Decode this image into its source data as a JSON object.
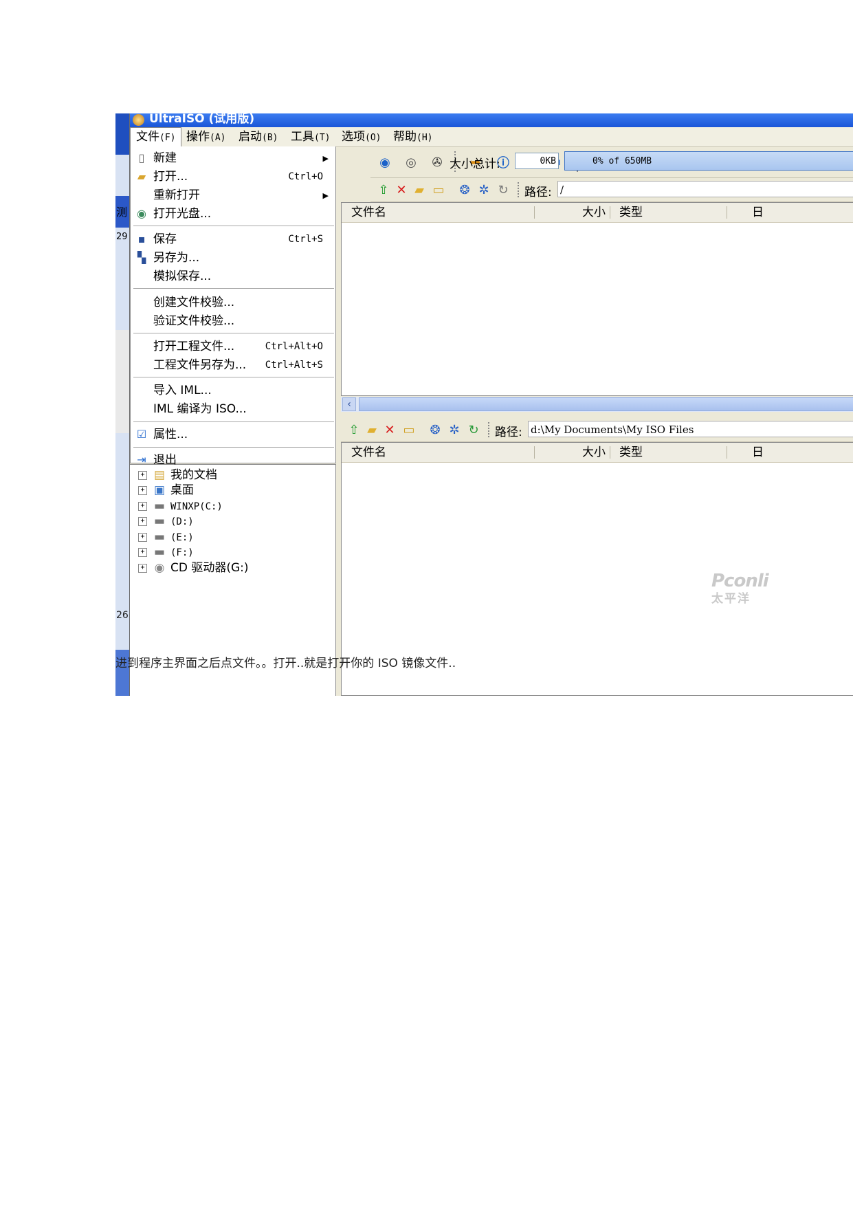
{
  "window": {
    "title": "UltraISO (试用版)"
  },
  "desktop_strip": {
    "text_1": "测",
    "text_2": "29",
    "text_3": "26"
  },
  "menubar": {
    "items": [
      {
        "label": "文件",
        "key": "(F)"
      },
      {
        "label": "操作",
        "key": "(A)"
      },
      {
        "label": "启动",
        "key": "(B)"
      },
      {
        "label": "工具",
        "key": "(T)"
      },
      {
        "label": "选项",
        "key": "(O)"
      },
      {
        "label": "帮助",
        "key": "(H)"
      }
    ]
  },
  "file_menu": {
    "new": "新建",
    "open": "打开...",
    "open_shortcut": "Ctrl+O",
    "reopen": "重新打开",
    "open_disc": "打开光盘...",
    "save": "保存",
    "save_shortcut": "Ctrl+S",
    "save_as": "另存为...",
    "simulate_save": "模拟保存...",
    "create_checksum": "创建文件校验...",
    "verify_checksum": "验证文件校验...",
    "open_project": "打开工程文件...",
    "open_project_shortcut": "Ctrl+Alt+O",
    "save_project_as": "工程文件另存为...",
    "save_project_shortcut": "Ctrl+Alt+S",
    "import_iml": "导入 IML...",
    "compile_iml": "IML 编译为 ISO...",
    "properties": "属性...",
    "exit": "退出"
  },
  "toolbar": {
    "size_total_label": "大小总计:",
    "size_value": "0KB",
    "capacity": "0% of 650MB"
  },
  "upper_panel": {
    "path_label": "路径:",
    "path_value": "/",
    "columns": [
      "文件名",
      "大小",
      "类型",
      "日"
    ]
  },
  "lower_panel": {
    "path_label": "路径:",
    "path_value": "d:\\My Documents\\My ISO Files",
    "columns": [
      "文件名",
      "大小",
      "类型",
      "日"
    ]
  },
  "tree": [
    {
      "label": "我的文档",
      "icon": "documents-folder-icon"
    },
    {
      "label": "桌面",
      "icon": "desktop-icon"
    },
    {
      "label": "WINXP(C:)",
      "icon": "drive-icon"
    },
    {
      "label": "(D:)",
      "icon": "drive-icon"
    },
    {
      "label": "(E:)",
      "icon": "drive-icon"
    },
    {
      "label": "(F:)",
      "icon": "drive-icon"
    },
    {
      "label": "CD 驱动器(G:)",
      "icon": "cd-drive-icon"
    }
  ],
  "watermark": {
    "main": "Pconli",
    "sub": "太平洋"
  },
  "caption": "进到程序主界面之后点文件。。打开..就是打开你的 ISO 镜像文件.."
}
